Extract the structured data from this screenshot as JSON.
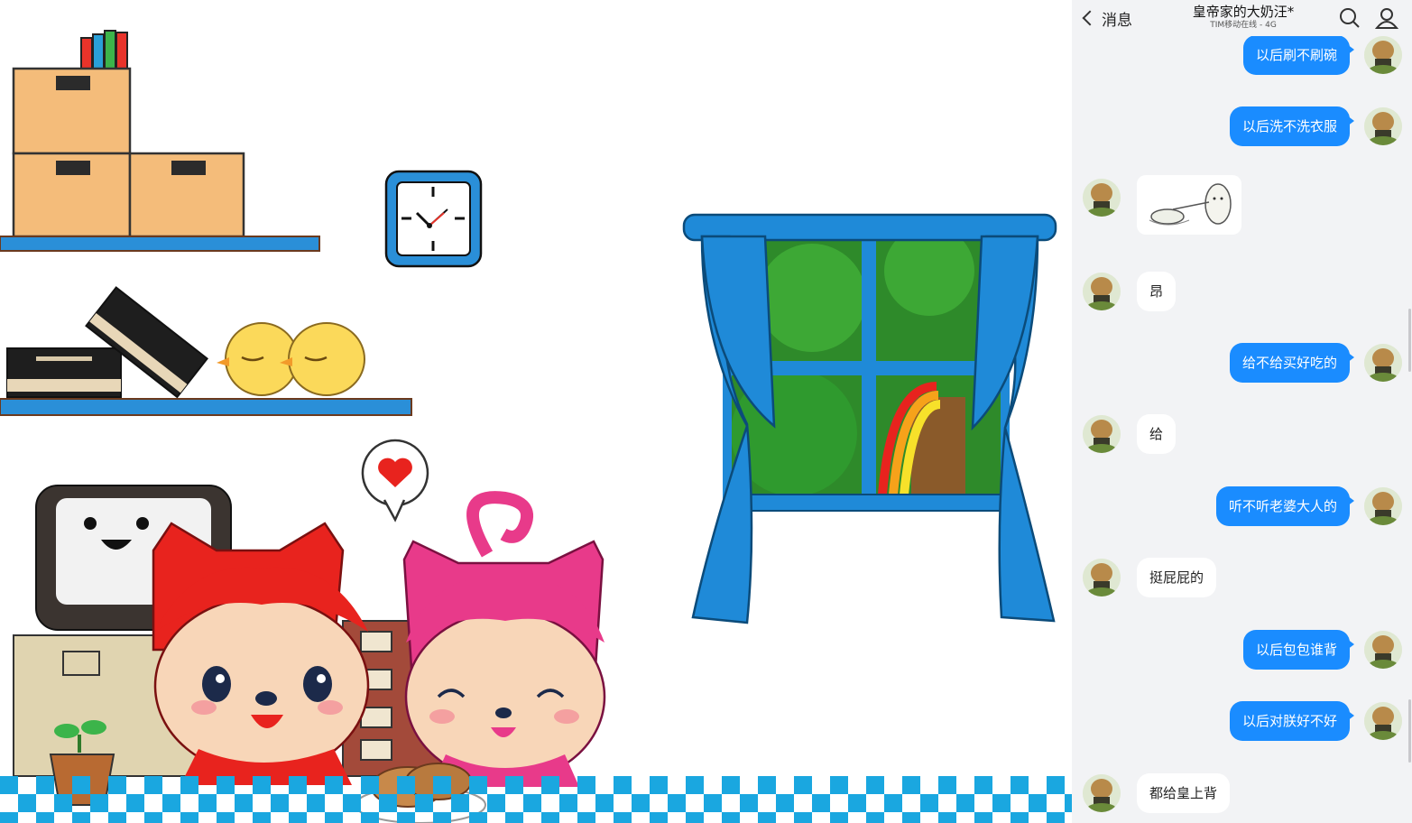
{
  "header": {
    "back_label": "消息",
    "title": "皇帝家的大奶汪*",
    "subtitle": "TIM移动在线 - 4G",
    "search_icon": "search-icon",
    "profile_icon": "user-icon"
  },
  "messages": [
    {
      "side": "out",
      "type": "text",
      "text": "以后刷不刷碗"
    },
    {
      "side": "out",
      "type": "text",
      "text": "以后洗不洗衣服"
    },
    {
      "side": "in",
      "type": "sticker",
      "text": ""
    },
    {
      "side": "in",
      "type": "text",
      "text": "昂"
    },
    {
      "side": "out",
      "type": "text",
      "text": "给不给买好吃的"
    },
    {
      "side": "in",
      "type": "text",
      "text": "给"
    },
    {
      "side": "out",
      "type": "text",
      "text": "听不听老婆大人的"
    },
    {
      "side": "in",
      "type": "text",
      "text": "挺屁屁的"
    },
    {
      "side": "out",
      "type": "text",
      "text": "以后包包谁背"
    },
    {
      "side": "out",
      "type": "text",
      "text": "以后对朕好不好"
    },
    {
      "side": "in",
      "type": "text",
      "text": "都给皇上背"
    }
  ],
  "colors": {
    "bubble_out": "#1a8cff",
    "bubble_in": "#ffffff",
    "chat_bg": "#f2f3f5",
    "shelf_blue": "#2a8fd8",
    "box_tan": "#f4bc7a",
    "curtain_blue": "#1f8ad8",
    "fox_red": "#e8231e",
    "fox_pink": "#e83a8a",
    "floor_check": "#1aa7e0"
  }
}
